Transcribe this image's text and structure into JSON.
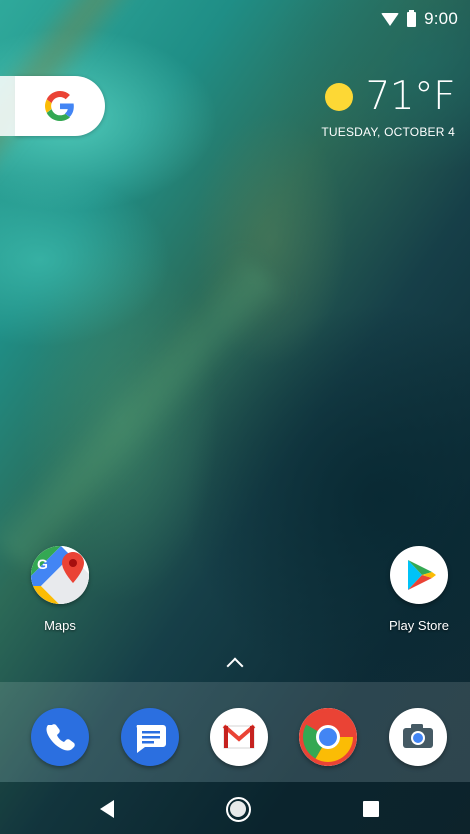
{
  "status_bar": {
    "time": "9:00",
    "icons": [
      "wifi-icon",
      "battery-icon"
    ]
  },
  "search": {
    "icon": "google-icon"
  },
  "weather": {
    "icon": "sun-icon",
    "temperature": "71°F",
    "date": "TUESDAY, OCTOBER 4"
  },
  "home_apps": [
    {
      "label": "Maps",
      "icon": "maps-icon"
    },
    {
      "label": "Play Store",
      "icon": "play-store-icon"
    }
  ],
  "dock": [
    {
      "icon": "phone-icon"
    },
    {
      "icon": "messages-icon"
    },
    {
      "icon": "gmail-icon"
    },
    {
      "icon": "chrome-icon"
    },
    {
      "icon": "camera-icon"
    }
  ],
  "nav_bar": {
    "icons": [
      "back-icon",
      "home-icon",
      "recents-icon"
    ]
  },
  "colors": {
    "google_blue": "#4285F4",
    "google_red": "#EA4335",
    "google_yellow": "#FBBC05",
    "google_green": "#34A853",
    "sun": "#FDD835",
    "dock_blue": "#2B6FE0"
  }
}
